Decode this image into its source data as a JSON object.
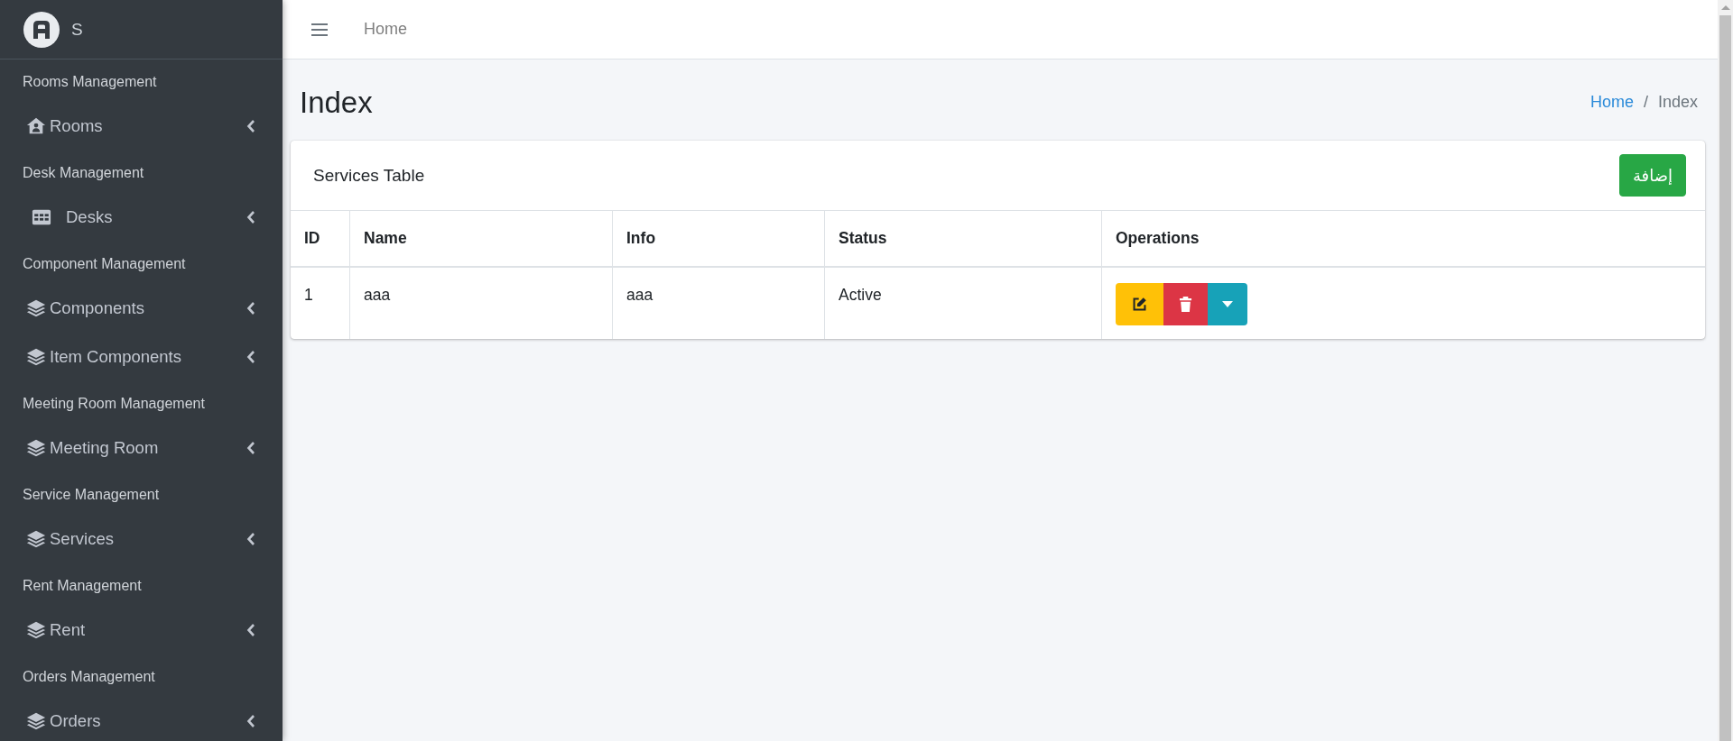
{
  "sidebar": {
    "brand": "S",
    "sections": [
      {
        "title": "Rooms Management",
        "items": [
          {
            "label": "Rooms",
            "expanded": false
          }
        ]
      },
      {
        "title": "Desk Management",
        "items": [
          {
            "label": "Desks",
            "expanded": false
          }
        ]
      },
      {
        "title": "Component Management",
        "items": [
          {
            "label": "Components",
            "expanded": false
          },
          {
            "label": "Item Components",
            "expanded": false
          }
        ]
      },
      {
        "title": "Meeting Room Management",
        "items": [
          {
            "label": "Meeting Room",
            "expanded": false
          }
        ]
      },
      {
        "title": "Service Management",
        "items": [
          {
            "label": "Services",
            "expanded": false
          }
        ]
      },
      {
        "title": "Rent Management",
        "items": [
          {
            "label": "Rent",
            "expanded": false
          }
        ]
      },
      {
        "title": "Orders Management",
        "items": [
          {
            "label": "Orders",
            "expanded": false
          }
        ]
      }
    ]
  },
  "topbar": {
    "link": "Home"
  },
  "page": {
    "title": "Index",
    "breadcrumb": [
      {
        "label": "Home",
        "link": true
      },
      {
        "label": "Index",
        "link": false
      }
    ],
    "separator": "/"
  },
  "card": {
    "title": "Services Table",
    "add_button": "إضافة",
    "table": {
      "columns": [
        "ID",
        "Name",
        "Info",
        "Status",
        "Operations"
      ],
      "rows": [
        {
          "cells": [
            "1",
            "aaa",
            "aaa",
            "Active"
          ]
        }
      ]
    }
  }
}
